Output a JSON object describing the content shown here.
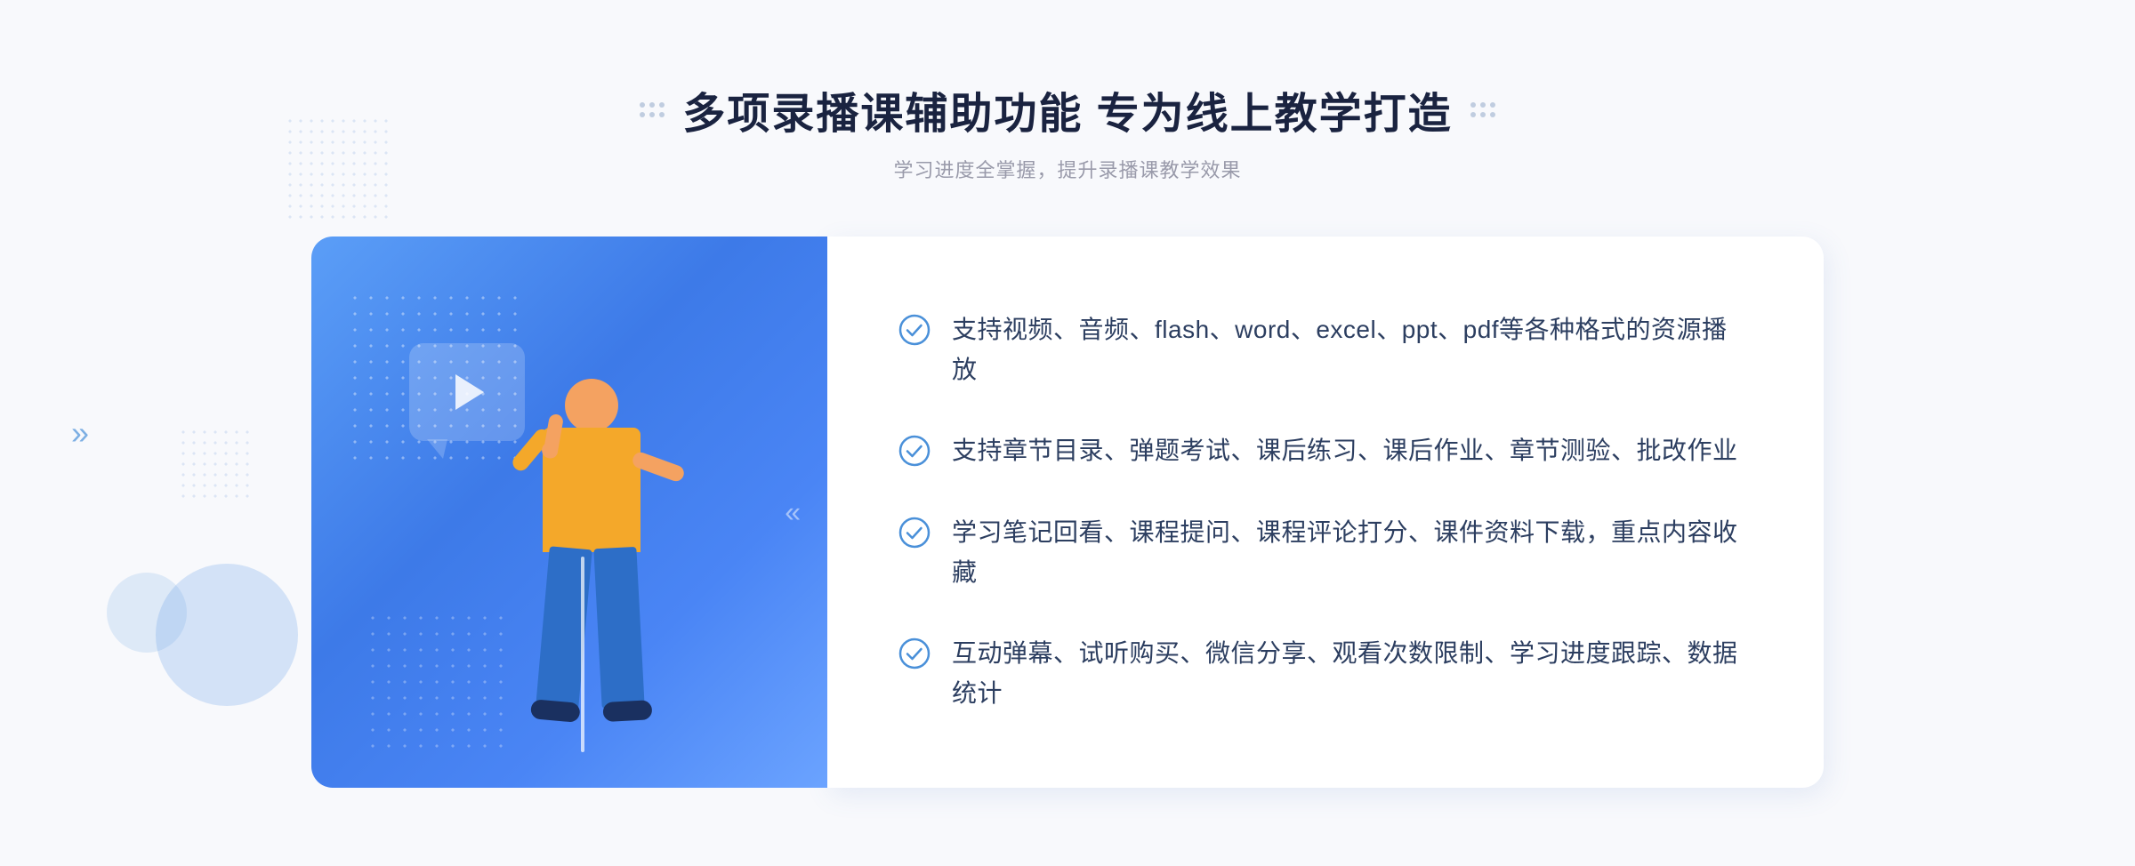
{
  "header": {
    "title": "多项录播课辅助功能 专为线上教学打造",
    "subtitle": "学习进度全掌握，提升录播课教学效果"
  },
  "features": [
    {
      "id": 1,
      "text": "支持视频、音频、flash、word、excel、ppt、pdf等各种格式的资源播放"
    },
    {
      "id": 2,
      "text": "支持章节目录、弹题考试、课后练习、课后作业、章节测验、批改作业"
    },
    {
      "id": 3,
      "text": "学习笔记回看、课程提问、课程评论打分、课件资料下载，重点内容收藏"
    },
    {
      "id": 4,
      "text": "互动弹幕、试听购买、微信分享、观看次数限制、学习进度跟踪、数据统计"
    }
  ],
  "colors": {
    "primary_blue": "#3d7ae8",
    "light_blue": "#5b9ef7",
    "text_dark": "#1a2340",
    "text_body": "#2c3e60",
    "text_muted": "#999aaa",
    "check_color": "#4a90d9"
  }
}
